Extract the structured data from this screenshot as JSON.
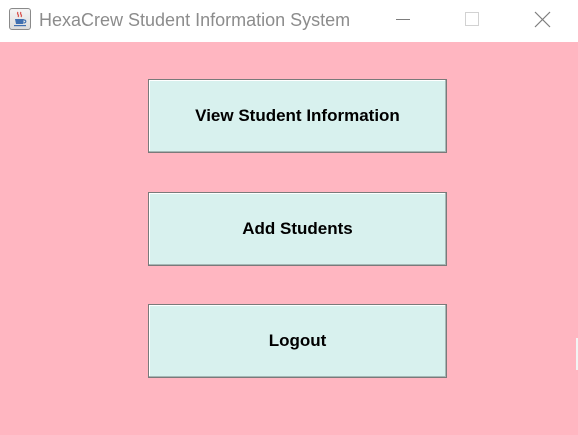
{
  "window": {
    "title": "HexaCrew Student Information System",
    "icon": "java-cup-icon",
    "controls": [
      "minimize-icon",
      "maximize-icon",
      "close-icon"
    ]
  },
  "main": {
    "background_color": "#ffb6c1",
    "button_color": "#d8f1ee",
    "buttons": [
      {
        "label": "View Student Information"
      },
      {
        "label": "Add Students"
      },
      {
        "label": "Logout"
      }
    ]
  }
}
